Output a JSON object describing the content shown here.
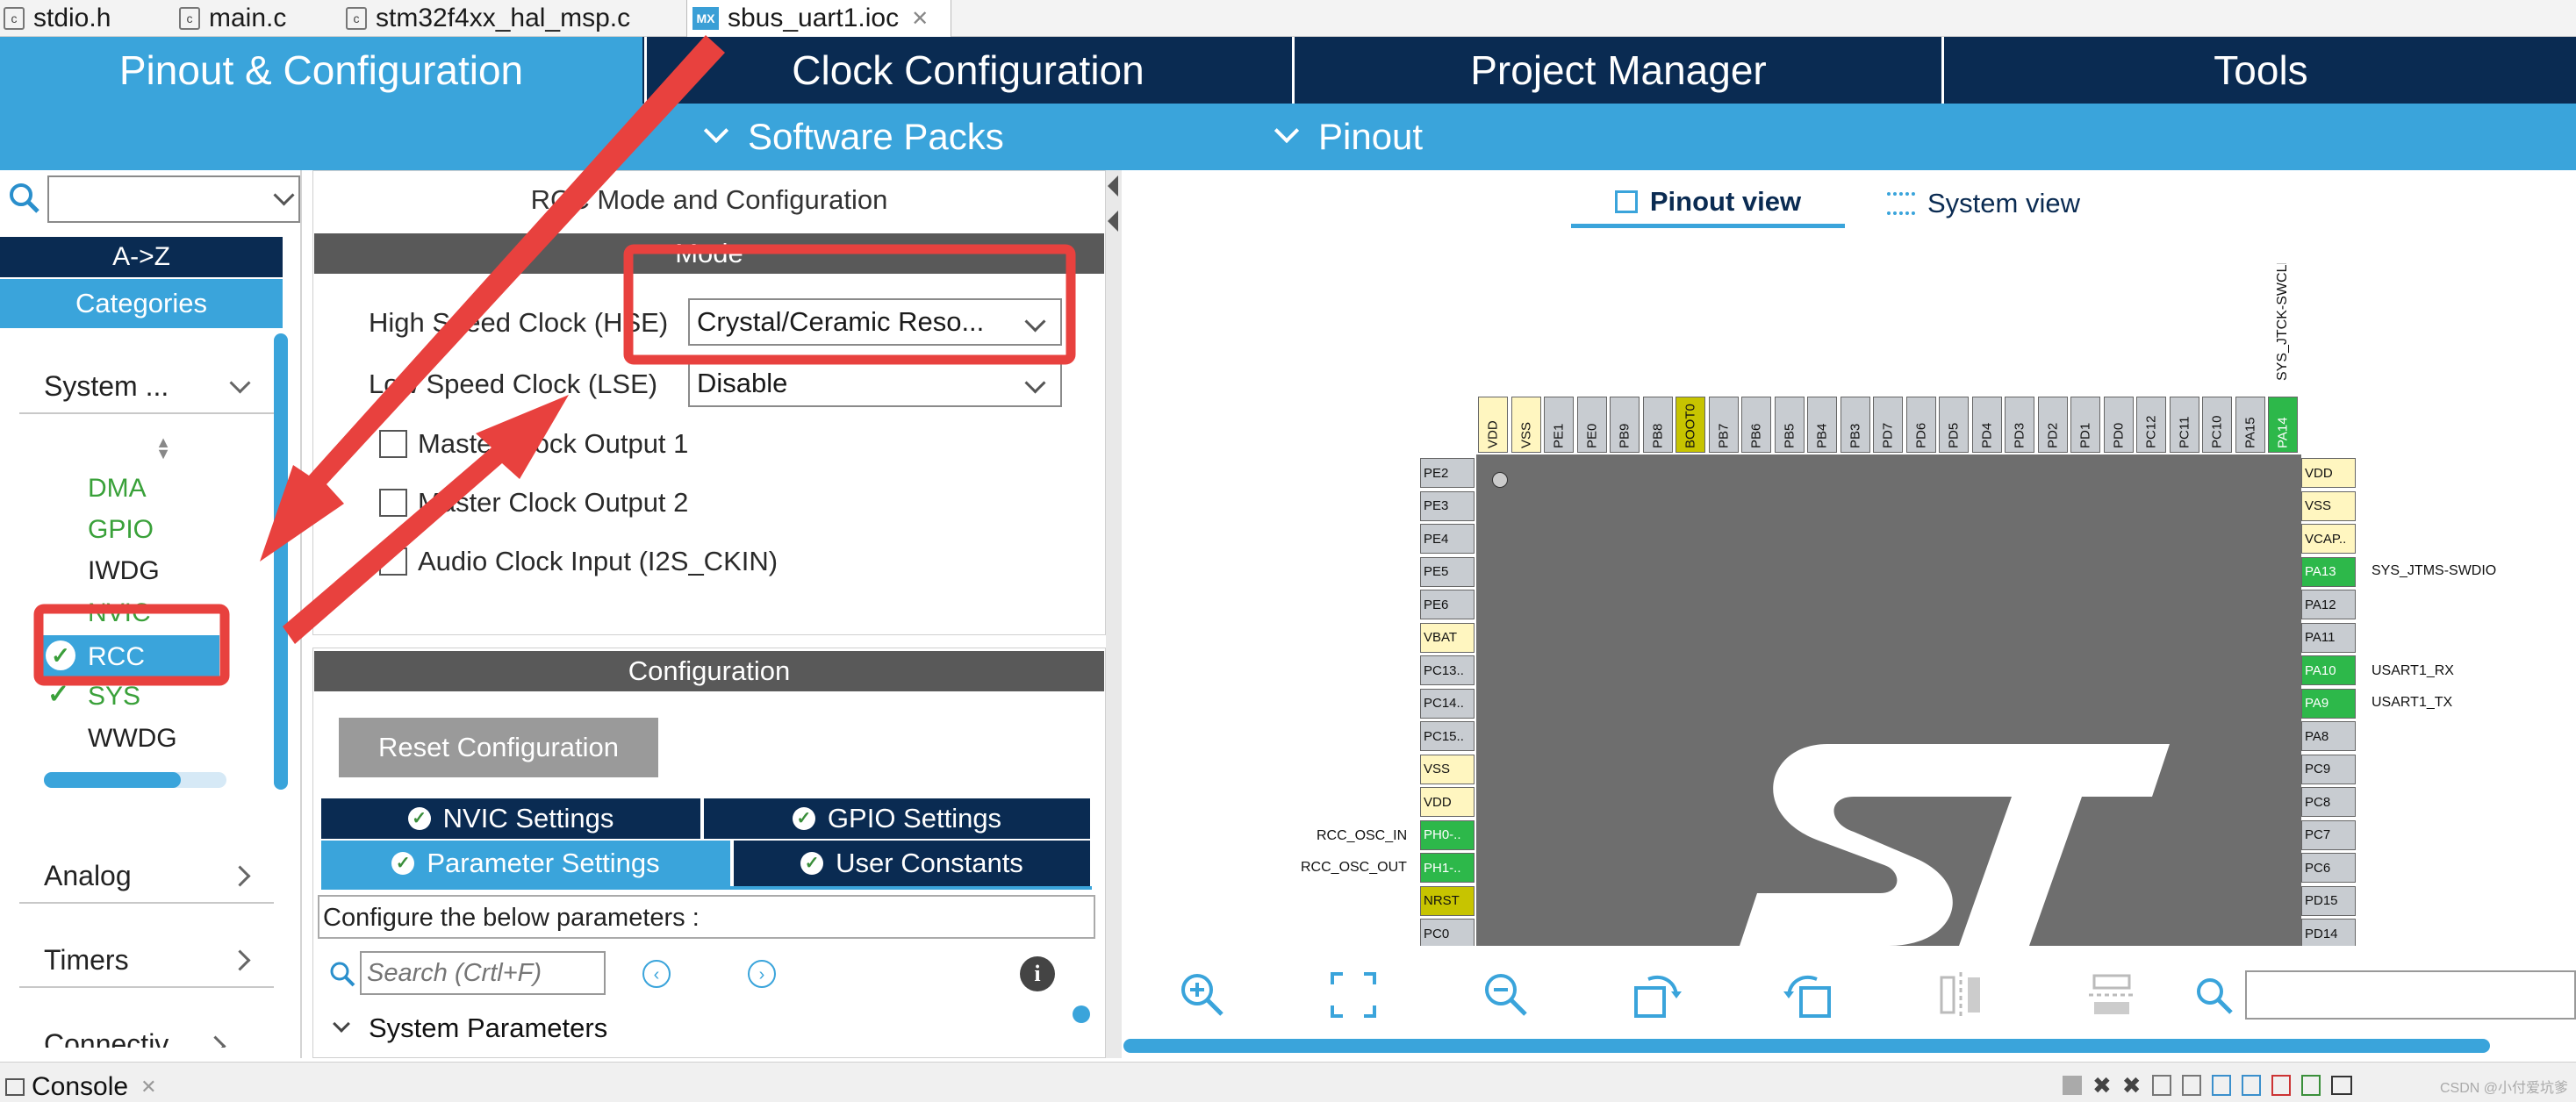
{
  "file_tabs": [
    {
      "label": "stdio.h",
      "icon": "file-c-icon"
    },
    {
      "label": "main.c",
      "icon": "file-c-icon"
    },
    {
      "label": "stm32f4xx_hal_msp.c",
      "icon": "file-c-icon"
    },
    {
      "label": "sbus_uart1.ioc",
      "icon": "mx-file-icon",
      "badge": "MX",
      "active": true
    }
  ],
  "top_nav": [
    "Pinout & Configuration",
    "Clock Configuration",
    "Project Manager",
    "Tools"
  ],
  "sub_nav": [
    "Software Packs",
    "Pinout"
  ],
  "sidebar": {
    "search_value": "",
    "az_label": "A->Z",
    "categories_label": "Categories",
    "system_group": "System ...",
    "system_items": [
      {
        "label": "DMA",
        "color": "#3aa13a",
        "check": false
      },
      {
        "label": "GPIO",
        "color": "#3aa13a",
        "check": false
      },
      {
        "label": "IWDG",
        "color": "#222222",
        "check": false
      },
      {
        "label": "NVIC",
        "color": "#3aa13a",
        "check": false
      },
      {
        "label": "RCC",
        "color": "#ffffff",
        "check": true,
        "selected": true
      },
      {
        "label": "SYS",
        "color": "#3aa13a",
        "check": true
      },
      {
        "label": "WWDG",
        "color": "#222222",
        "check": false
      }
    ],
    "groups": [
      "Analog",
      "Timers",
      "Connectiv..."
    ]
  },
  "rcc": {
    "title": "RCC Mode and Configuration",
    "mode_header": "Mode",
    "hse_label": "High Speed Clock (HSE)",
    "hse_value": "Crystal/Ceramic Reso...",
    "lse_label": "Low Speed Clock (LSE)",
    "lse_value": "Disable",
    "checkboxes": [
      "Master Clock Output 1",
      "Master Clock Output 2",
      "Audio Clock Input (I2S_CKIN)"
    ],
    "config_header": "Configuration",
    "reset_button": "Reset Configuration",
    "tabs": [
      "NVIC Settings",
      "GPIO Settings",
      "Parameter Settings",
      "User Constants"
    ],
    "configure_text": "Configure the below parameters :",
    "search_placeholder": "Search (Crtl+F)",
    "system_parameters": "System Parameters"
  },
  "view_tabs": [
    "Pinout view",
    "System view"
  ],
  "chip": {
    "top_pins": [
      "VDD",
      "VSS",
      "PE1",
      "PE0",
      "PB9",
      "PB8",
      "BOOT0",
      "PB7",
      "PB6",
      "PB5",
      "PB4",
      "PB3",
      "PD7",
      "PD6",
      "PD5",
      "PD4",
      "PD3",
      "PD2",
      "PD1",
      "PD0",
      "PC12",
      "PC11",
      "PC10",
      "PA15",
      "PA14"
    ],
    "left_pins": [
      "PE2",
      "PE3",
      "PE4",
      "PE5",
      "PE6",
      "VBAT",
      "PC13..",
      "PC14..",
      "PC15..",
      "VSS",
      "VDD",
      "PH0-..",
      "PH1-..",
      "NRST",
      "PC0"
    ],
    "right_pins": [
      "VDD",
      "VSS",
      "VCAP..",
      "PA13",
      "PA12",
      "PA11",
      "PA10",
      "PA9",
      "PA8",
      "PC9",
      "PC8",
      "PC7",
      "PC6",
      "PD15",
      "PD14"
    ],
    "labels": {
      "pa14": "SYS_JTCK-SWCLK",
      "pa13": "SYS_JTMS-SWDIO",
      "pa10": "USART1_RX",
      "pa9": "USART1_TX",
      "ph0": "RCC_OSC_IN",
      "ph1": "RCC_OSC_OUT"
    }
  },
  "bottom": {
    "console_label": "Console",
    "watermark": "CSDN @小付爱坑爹"
  }
}
